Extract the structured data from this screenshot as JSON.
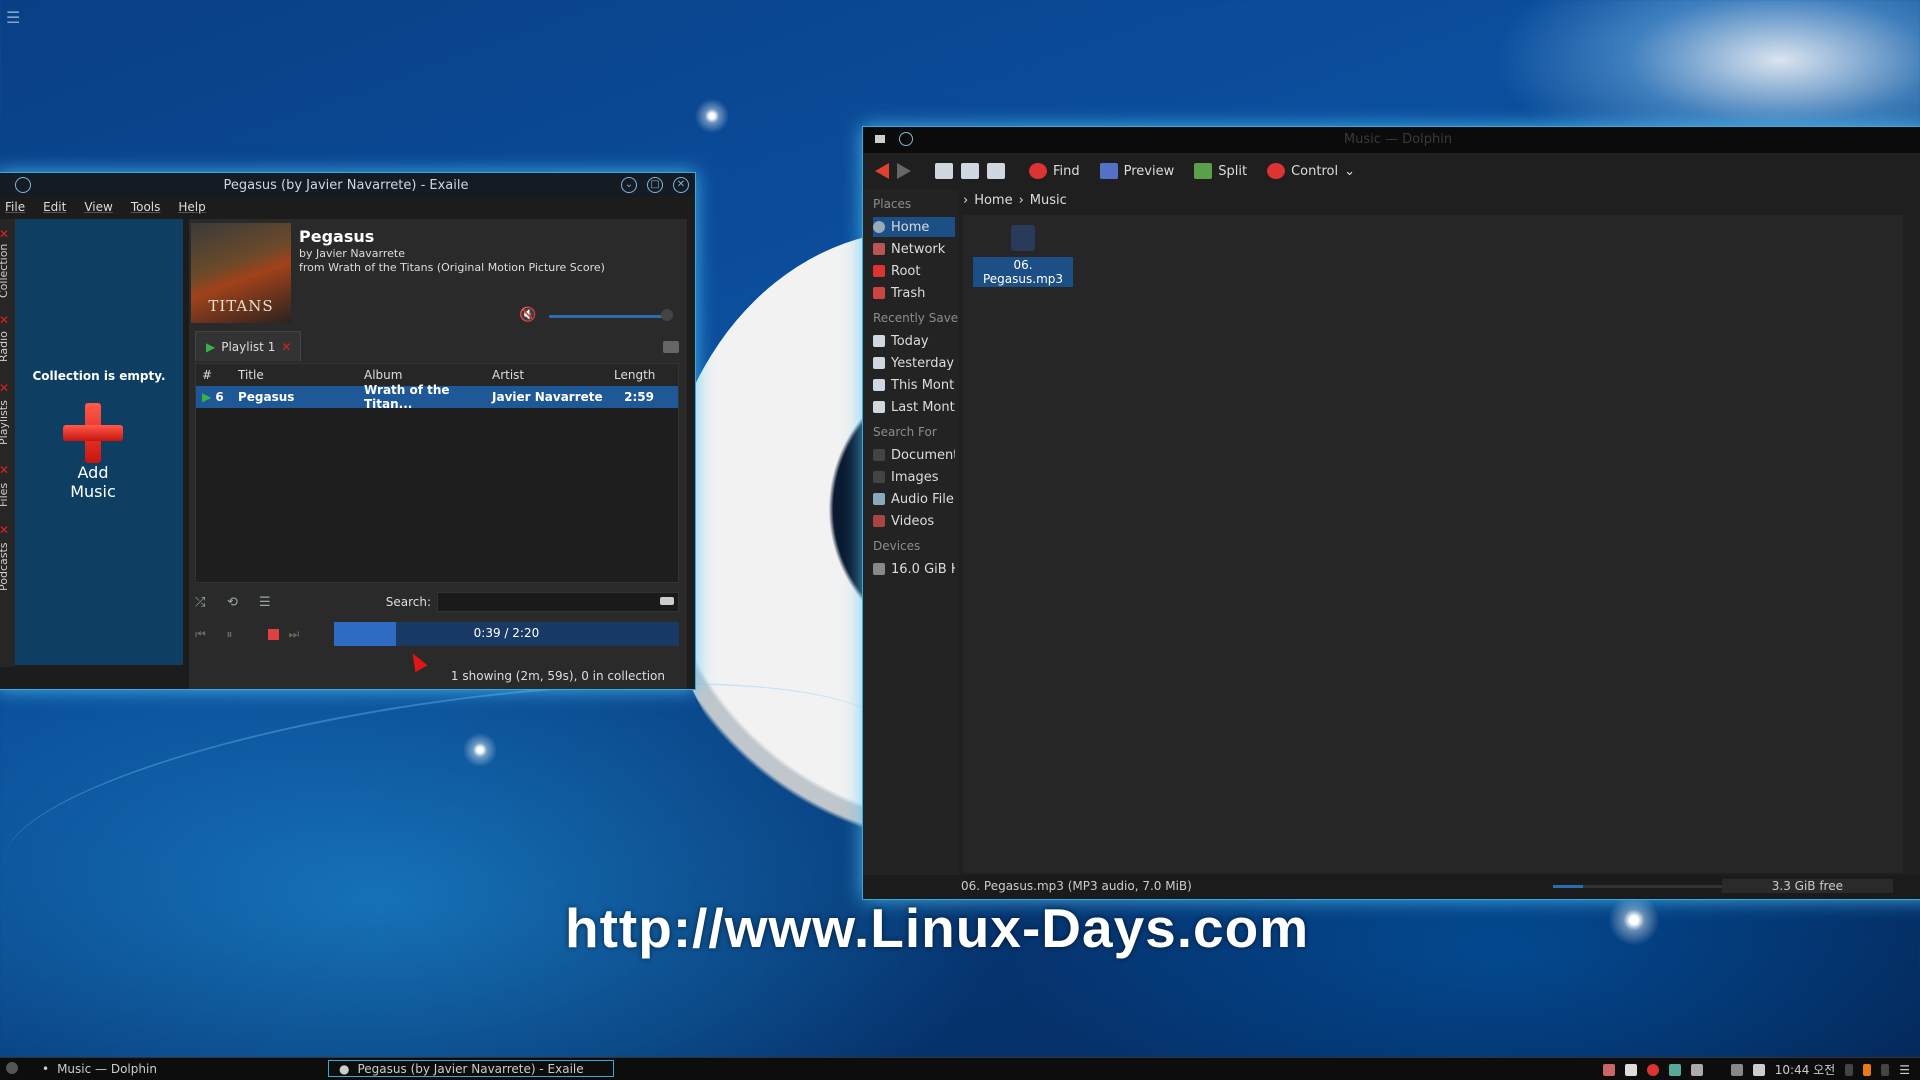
{
  "exaile": {
    "title": "Pegasus (by Javier Navarrete) - Exaile",
    "menu": [
      "File",
      "Edit",
      "View",
      "Tools",
      "Help"
    ],
    "side_tabs": [
      "Collection",
      "Radio",
      "Playlists",
      "Files",
      "Podcasts"
    ],
    "collection_empty": "Collection is empty.",
    "add_music": "Add Music",
    "track": {
      "title": "Pegasus",
      "by": "by Javier Navarrete",
      "from": "from Wrath of the Titans (Original Motion Picture Score)",
      "cover_text": "TITANS"
    },
    "playlist_tab": "Playlist 1",
    "columns": [
      "#",
      "Title",
      "Album",
      "Artist",
      "Length"
    ],
    "rows": [
      {
        "num": "6",
        "title": "Pegasus",
        "album": "Wrath of the Titan...",
        "artist": "Javier Navarrete",
        "length": "2:59"
      }
    ],
    "search_label": "Search:",
    "progress_fraction": 0.18,
    "time": "0:39 / 2:20",
    "status": "1 showing (2m, 59s), 0 in collection",
    "icons": [
      "shuffle-icon",
      "repeat-icon",
      "dynamic-icon",
      "prev-icon",
      "pause-icon",
      "stop-icon",
      "next-icon",
      "volume-icon"
    ]
  },
  "dolphin": {
    "title": "Music — Dolphin",
    "toolbar": {
      "find": "Find",
      "preview": "Preview",
      "split": "Split",
      "control": "Control"
    },
    "places_header": "Places",
    "places": [
      "Home",
      "Network",
      "Root",
      "Trash"
    ],
    "recent_header": "Recently Save",
    "recent": [
      "Today",
      "Yesterday",
      "This Montl",
      "Last Mont"
    ],
    "search_header": "Search For",
    "search": [
      "Document",
      "Images",
      "Audio File",
      "Videos"
    ],
    "devices_header": "Devices",
    "devices": [
      "16.0 GiB H"
    ],
    "breadcrumb": [
      "Home",
      "Music"
    ],
    "file": "06. Pegasus.mp3",
    "status": "06. Pegasus.mp3 (MP3 audio, 7.0 MiB)",
    "free": "3.3 GiB free"
  },
  "watermark": "http://www.Linux-Days.com",
  "taskbar": {
    "tasks": [
      "Music — Dolphin",
      "Pegasus (by Javier Navarrete) - Exaile"
    ],
    "clock": "10:44 오전"
  },
  "colors": {
    "accent": "#39a9d8",
    "selection": "#1c4f86",
    "red": "#e02020"
  }
}
